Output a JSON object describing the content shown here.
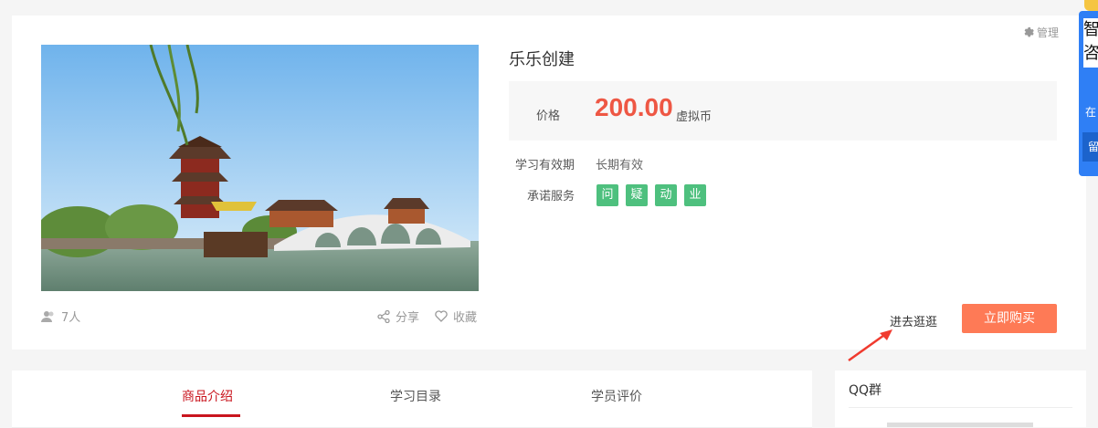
{
  "product": {
    "manage_label": "管理",
    "title": "乐乐创建",
    "price_label": "价格",
    "price_amount": "200.00",
    "price_unit": "虚拟币",
    "validity_label": "学习有效期",
    "validity_value": "长期有效",
    "service_label": "承诺服务",
    "services": [
      "问",
      "疑",
      "动",
      "业"
    ],
    "students_count": "7人",
    "share_label": "分享",
    "favorite_label": "收藏",
    "visit_label": "进去逛逛",
    "buy_label": "立即购买"
  },
  "tabs": [
    {
      "label": "商品介绍",
      "active": true
    },
    {
      "label": "学习目录",
      "active": false
    },
    {
      "label": "学员评价",
      "active": false
    }
  ],
  "sidebar": {
    "qq_title": "QQ群"
  },
  "widget": {
    "box_text": "智咨",
    "text": "在",
    "button": "留"
  },
  "colors": {
    "accent_red": "#c9151e",
    "price": "#ee5744",
    "buy_button": "#fe7a56",
    "tag_green": "#4ec07e",
    "widget_blue": "#2f7ff5"
  },
  "icons": [
    "gear-icon",
    "users-icon",
    "share-icon",
    "heart-icon",
    "arrow-icon"
  ]
}
